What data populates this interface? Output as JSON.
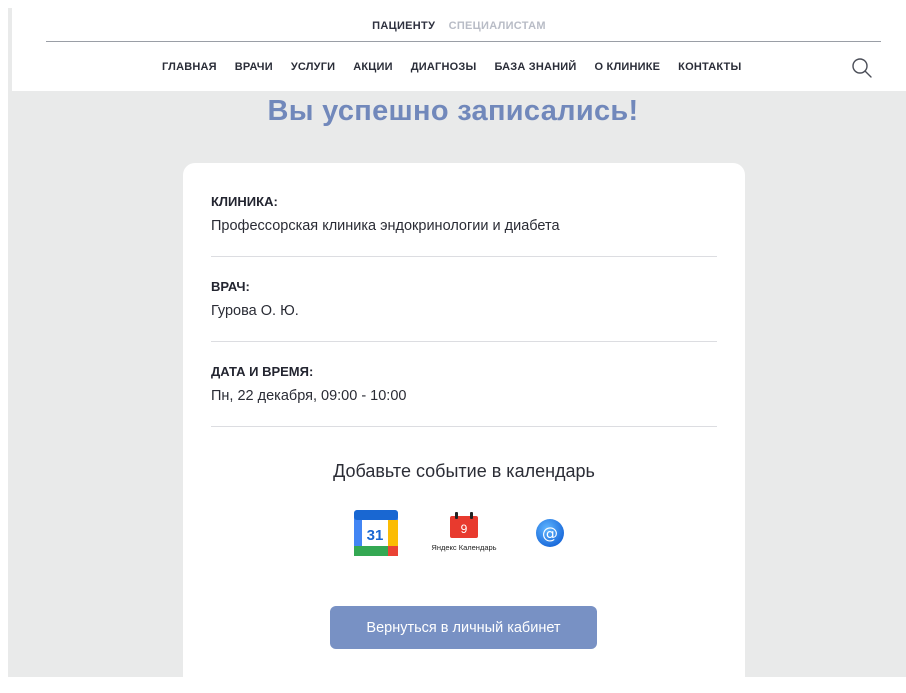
{
  "header": {
    "audience_tabs": [
      {
        "label": "ПАЦИЕНТУ",
        "active": true
      },
      {
        "label": "СПЕЦИАЛИСТАМ",
        "active": false
      }
    ],
    "nav": [
      {
        "label": "ГЛАВНАЯ"
      },
      {
        "label": "ВРАЧИ"
      },
      {
        "label": "УСЛУГИ"
      },
      {
        "label": "АКЦИИ"
      },
      {
        "label": "ДИАГНОЗЫ"
      },
      {
        "label": "БАЗА ЗНАНИЙ"
      },
      {
        "label": "О КЛИНИКЕ"
      },
      {
        "label": "КОНТАКТЫ"
      }
    ],
    "search_icon": "search-icon"
  },
  "main": {
    "title": "Вы успешно записались!",
    "clinic": {
      "label": "КЛИНИКА:",
      "value": "Профессорская клиника эндокринологии и диабета"
    },
    "doctor": {
      "label": "ВРАЧ:",
      "value": "Гурова О. Ю."
    },
    "datetime": {
      "label": "ДАТА И ВРЕМЯ:",
      "value": "Пн, 22 декабря, 09:00 - 10:00"
    },
    "calendar": {
      "caption": "Добавьте событие в календарь",
      "google": {
        "icon": "google-calendar-icon",
        "day": "31"
      },
      "yandex": {
        "icon": "yandex-calendar-icon",
        "day": "9",
        "label": "Яндекс Календарь"
      },
      "mail": {
        "icon": "mail-calendar-icon",
        "symbol": "@"
      }
    },
    "back_button": "Вернуться в личный кабинет"
  },
  "colors": {
    "accent": "#7188bb",
    "button": "#7891c4",
    "background": "#e9eaea"
  }
}
